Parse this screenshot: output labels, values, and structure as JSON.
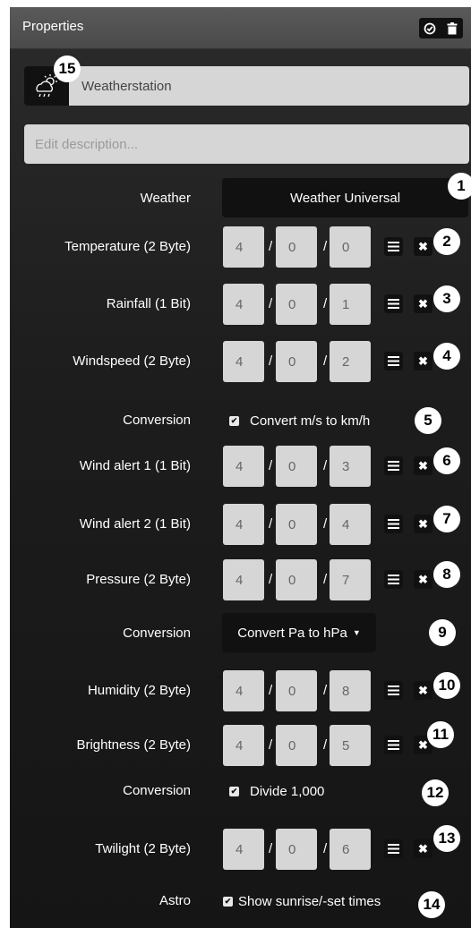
{
  "header": {
    "title": "Properties",
    "tools": [
      "check-circle-icon",
      "trash-icon"
    ]
  },
  "device": {
    "name": "Weatherstation",
    "icon": "weather-icon",
    "description_placeholder": "Edit description..."
  },
  "weather": {
    "label": "Weather",
    "selected": "Weather Universal"
  },
  "ga_rows": [
    {
      "label": "Temperature (2 Byte)",
      "ga": [
        "4",
        "0",
        "0"
      ],
      "badge": "2"
    },
    {
      "label": "Rainfall (1 Bit)",
      "ga": [
        "4",
        "0",
        "1"
      ],
      "badge": "3"
    },
    {
      "label": "Windspeed (2 Byte)",
      "ga": [
        "4",
        "0",
        "2"
      ],
      "badge": "4"
    },
    {
      "label": "Wind alert 1 (1 Bit)",
      "ga": [
        "4",
        "0",
        "3"
      ],
      "badge": "6"
    },
    {
      "label": "Wind alert 2 (1 Bit)",
      "ga": [
        "4",
        "0",
        "4"
      ],
      "badge": "7"
    },
    {
      "label": "Pressure (2 Byte)",
      "ga": [
        "4",
        "0",
        "7"
      ],
      "badge": "8"
    },
    {
      "label": "Humidity (2 Byte)",
      "ga": [
        "4",
        "0",
        "8"
      ],
      "badge": "10"
    },
    {
      "label": "Brightness (2 Byte)",
      "ga": [
        "4",
        "0",
        "5"
      ],
      "badge": "11"
    },
    {
      "label": "Twilight (2 Byte)",
      "ga": [
        "4",
        "0",
        "6"
      ],
      "badge": "13"
    }
  ],
  "separator": "/",
  "conversion_wind": {
    "label": "Conversion",
    "text": "Convert m/s to km/h",
    "checked": true,
    "badge": "5"
  },
  "conversion_pressure": {
    "label": "Conversion",
    "selected": "Convert Pa to hPa",
    "badge": "9"
  },
  "conversion_brightness": {
    "label": "Conversion",
    "text": "Divide 1,000",
    "checked": true,
    "badge": "12"
  },
  "astro": {
    "label": "Astro",
    "text": "Show sunrise/-set times",
    "checked": true,
    "badge": "14"
  },
  "badges": {
    "weather": "1",
    "icon": "15"
  }
}
